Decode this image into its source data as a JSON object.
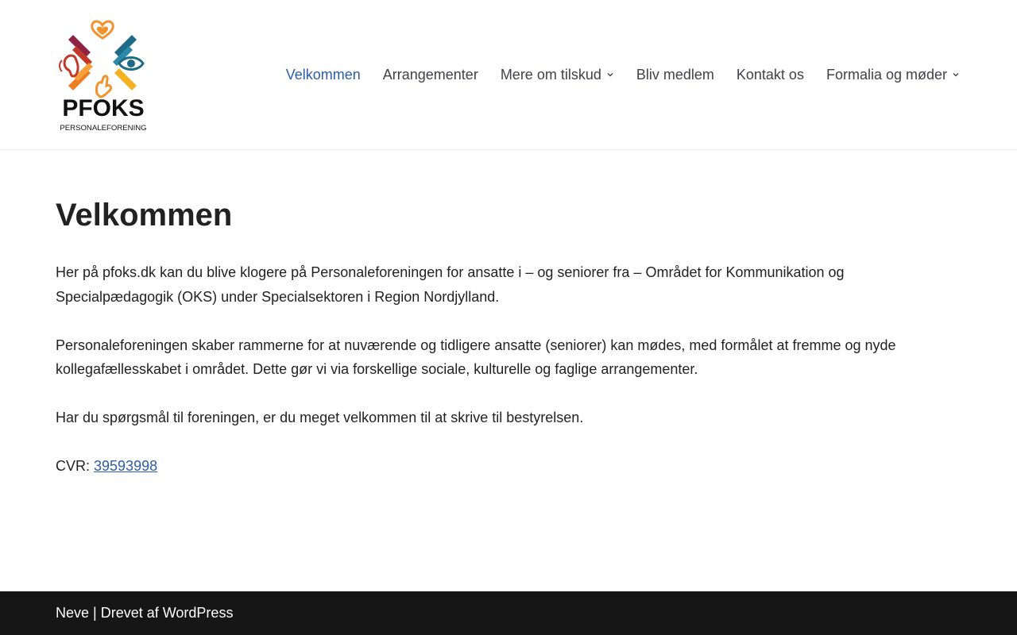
{
  "header": {
    "logo": {
      "name": "PFOKS",
      "tagline": "PERSONALEFORENING",
      "colors": {
        "heart": "#f0932b",
        "orange": "#ef7d22",
        "teal": "#1d6b86",
        "red": "#c0392b",
        "maroon": "#8e2344",
        "yellow": "#f4b223",
        "text": "#111111"
      }
    },
    "nav": [
      {
        "label": "Velkommen",
        "active": true,
        "has_dropdown": false
      },
      {
        "label": "Arrangementer",
        "active": false,
        "has_dropdown": false
      },
      {
        "label": "Mere om tilskud",
        "active": false,
        "has_dropdown": true
      },
      {
        "label": "Bliv medlem",
        "active": false,
        "has_dropdown": false
      },
      {
        "label": "Kontakt os",
        "active": false,
        "has_dropdown": false
      },
      {
        "label": "Formalia og møder",
        "active": false,
        "has_dropdown": true
      }
    ]
  },
  "main": {
    "title": "Velkommen",
    "paragraphs": [
      "Her på pfoks.dk kan du blive klogere på Personaleforeningen for ansatte i – og seniorer fra – Området for Kommunikation og Specialpædagogik (OKS) under Specialsektoren i Region Nordjylland.",
      "Personaleforeningen skaber rammerne for at nuværende og tidligere ansatte (seniorer) kan mødes, med formålet at fremme og nyde kollegafællesskabet i området. Dette gør vi via forskellige sociale, kulturelle og faglige arrangementer.",
      "Har du spørgsmål til foreningen, er du meget velkommen til at skrive til bestyrelsen."
    ],
    "cvr": {
      "label": "CVR: ",
      "number": "39593998"
    }
  },
  "footer": {
    "theme_link": "Neve",
    "separator": " | ",
    "powered_prefix": "Drevet af ",
    "wordpress_link": "WordPress"
  },
  "colors": {
    "accent": "#2b5dab",
    "text": "#222222",
    "nav_text": "#404248",
    "footer_bg": "#161616",
    "footer_text": "#ffffff"
  }
}
